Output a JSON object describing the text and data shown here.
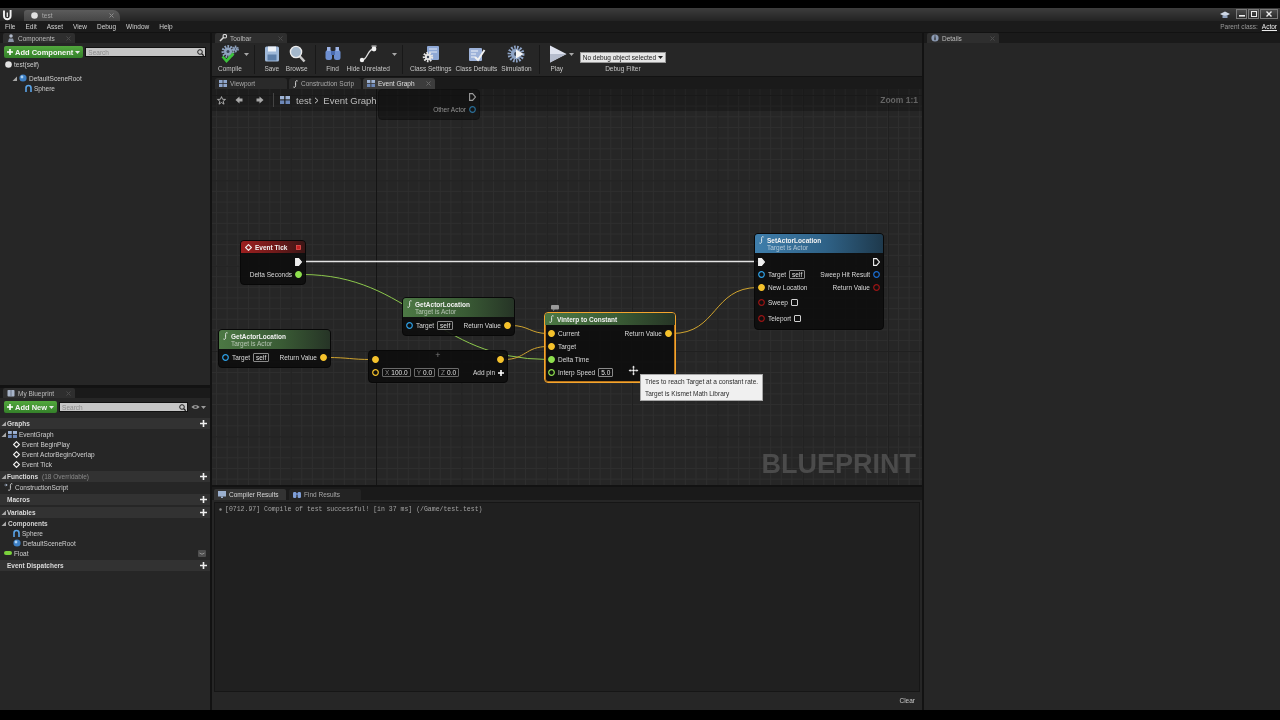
{
  "window": {
    "tab": "test",
    "menu": [
      "File",
      "Edit",
      "Asset",
      "View",
      "Debug",
      "Window",
      "Help"
    ],
    "parent_class_label": "Parent class:",
    "parent_class": "Actor"
  },
  "components": {
    "tab": "Components",
    "add_button": "Add Component",
    "search": {
      "placeholder": "Search"
    },
    "tree": [
      {
        "label": "test(self)",
        "kind": "actor",
        "children": [
          {
            "label": "DefaultSceneRoot",
            "kind": "scene_root",
            "expanded": true,
            "children": [
              {
                "label": "Sphere",
                "kind": "sphere"
              }
            ]
          }
        ]
      }
    ]
  },
  "my_blueprint": {
    "tab": "My Blueprint",
    "add_button": "Add New",
    "search": {
      "placeholder": "Search"
    },
    "sections": [
      {
        "label": "Graphs",
        "expanded": true,
        "addable": true,
        "items": [
          {
            "label": "EventGraph",
            "kind": "graph",
            "expanded": true,
            "children": [
              {
                "label": "Event BeginPlay",
                "kind": "event"
              },
              {
                "label": "Event ActorBeginOverlap",
                "kind": "event"
              },
              {
                "label": "Event Tick",
                "kind": "event"
              }
            ]
          }
        ]
      },
      {
        "label": "Functions",
        "note": "(18 Overridable)",
        "expanded": true,
        "addable": true,
        "items": [
          {
            "label": "ConstructionScript",
            "kind": "function"
          }
        ]
      },
      {
        "label": "Macros",
        "addable": true
      },
      {
        "label": "Variables",
        "expanded": true,
        "addable": true,
        "items": [
          {
            "label": "Components",
            "kind": "category",
            "expanded": true,
            "children": [
              {
                "label": "Sphere",
                "kind": "sphere"
              },
              {
                "label": "DefaultSceneRoot",
                "kind": "scene_root"
              }
            ]
          },
          {
            "label": "Float",
            "kind": "variable"
          }
        ]
      },
      {
        "label": "Event Dispatchers",
        "addable": true
      }
    ]
  },
  "toolbar": {
    "tab": "Toolbar",
    "groups": [
      [
        {
          "label": "Compile",
          "dropdown": true
        }
      ],
      [
        {
          "label": "Save",
          "dropdown": false
        },
        {
          "label": "Browse",
          "dropdown": false
        }
      ],
      [
        {
          "label": "Find",
          "dropdown": false
        },
        {
          "label": "Hide Unrelated",
          "dropdown": true
        }
      ],
      [
        {
          "label": "Class Settings",
          "dropdown": false
        },
        {
          "label": "Class Defaults",
          "dropdown": false
        },
        {
          "label": "Simulation",
          "dropdown": false
        }
      ],
      [
        {
          "label": "Play",
          "dropdown": true
        }
      ]
    ],
    "debug_filter": {
      "value": "No debug object selected",
      "label": "Debug Filter"
    }
  },
  "editor_tabs": [
    {
      "label": "Viewport",
      "selected": false
    },
    {
      "label": "Construction Scrip",
      "selected": false
    },
    {
      "label": "Event Graph",
      "selected": true
    }
  ],
  "graph": {
    "breadcrumb": [
      "test",
      "Event Graph"
    ],
    "zoom": "Zoom 1:1",
    "label": "BLUEPRINT",
    "partial_node": {
      "outputs": [
        {
          "kind": "exec",
          "connected": false
        },
        {
          "name": "Other Actor",
          "kind": "object",
          "connected": false
        }
      ]
    },
    "nodes": [
      {
        "kind": "event",
        "title": "Event Tick",
        "selected": false,
        "outputs": [
          {
            "kind": "exec",
            "connected": true
          },
          {
            "name": "Delta Seconds",
            "kind": "float",
            "connected": true
          }
        ]
      },
      {
        "kind": "pure",
        "title": "GetActorLocation",
        "subtitle": "Target is Actor",
        "selected": false,
        "inputs": [
          {
            "name": "Target",
            "kind": "object",
            "connected": false,
            "default": "self"
          }
        ],
        "outputs": [
          {
            "name": "Return Value",
            "kind": "vector",
            "connected": true
          }
        ]
      },
      {
        "kind": "pure",
        "title": "GetActorLocation",
        "subtitle": "Target is Actor",
        "selected": false,
        "inputs": [
          {
            "name": "Target",
            "kind": "object",
            "connected": false,
            "default": "self"
          }
        ],
        "outputs": [
          {
            "name": "Return Value",
            "kind": "vector",
            "connected": true
          }
        ]
      },
      {
        "kind": "compact",
        "symbol": "+",
        "selected": false,
        "inputs": [
          {
            "kind": "vector",
            "connected": true
          },
          {
            "kind": "vector",
            "connected": false,
            "vector_default": [
              {
                "axis": "X",
                "value": "100.0"
              },
              {
                "axis": "Y",
                "value": "0.0"
              },
              {
                "axis": "Z",
                "value": "0.0"
              }
            ]
          }
        ],
        "outputs": [
          {
            "kind": "vector",
            "connected": true
          }
        ],
        "add_pin": "Add pin"
      },
      {
        "kind": "pure",
        "title": "Vinterp to Constant",
        "selected": true,
        "inputs": [
          {
            "name": "Current",
            "kind": "vector",
            "connected": true
          },
          {
            "name": "Target",
            "kind": "vector",
            "connected": true
          },
          {
            "name": "Delta Time",
            "kind": "float",
            "connected": true
          },
          {
            "name": "Interp Speed",
            "kind": "float",
            "connected": false,
            "default": "5.0"
          }
        ],
        "outputs": [
          {
            "name": "Return Value",
            "kind": "vector",
            "connected": true
          }
        ]
      },
      {
        "kind": "function",
        "title": "SetActorLocation",
        "subtitle": "Target is Actor",
        "selected": false,
        "inputs": [
          {
            "kind": "exec",
            "connected": true
          },
          {
            "name": "Target",
            "kind": "object",
            "connected": false,
            "default": "self"
          },
          {
            "name": "New Location",
            "kind": "vector",
            "connected": true
          },
          {
            "name": "Sweep",
            "kind": "bool",
            "connected": false,
            "checked": false
          },
          {
            "name": "Teleport",
            "kind": "bool",
            "connected": false,
            "checked": false
          }
        ],
        "outputs": [
          {
            "kind": "exec",
            "connected": false
          },
          {
            "name": "Sweep Hit Result",
            "kind": "struct",
            "connected": false
          },
          {
            "name": "Return Value",
            "kind": "bool",
            "connected": false
          }
        ]
      }
    ],
    "tooltip": {
      "lines": [
        "Tries to reach Target at a constant rate.",
        "Target is Kismet Math Library"
      ]
    }
  },
  "compiler": {
    "tabs": [
      {
        "label": "Compiler Results",
        "selected": true
      },
      {
        "label": "Find Results",
        "selected": false
      }
    ],
    "log": [
      "[0712.97] Compile of test successful! [in 37 ms] (/Game/test.test)"
    ],
    "clear_button": "Clear"
  },
  "details": {
    "tab": "Details"
  }
}
